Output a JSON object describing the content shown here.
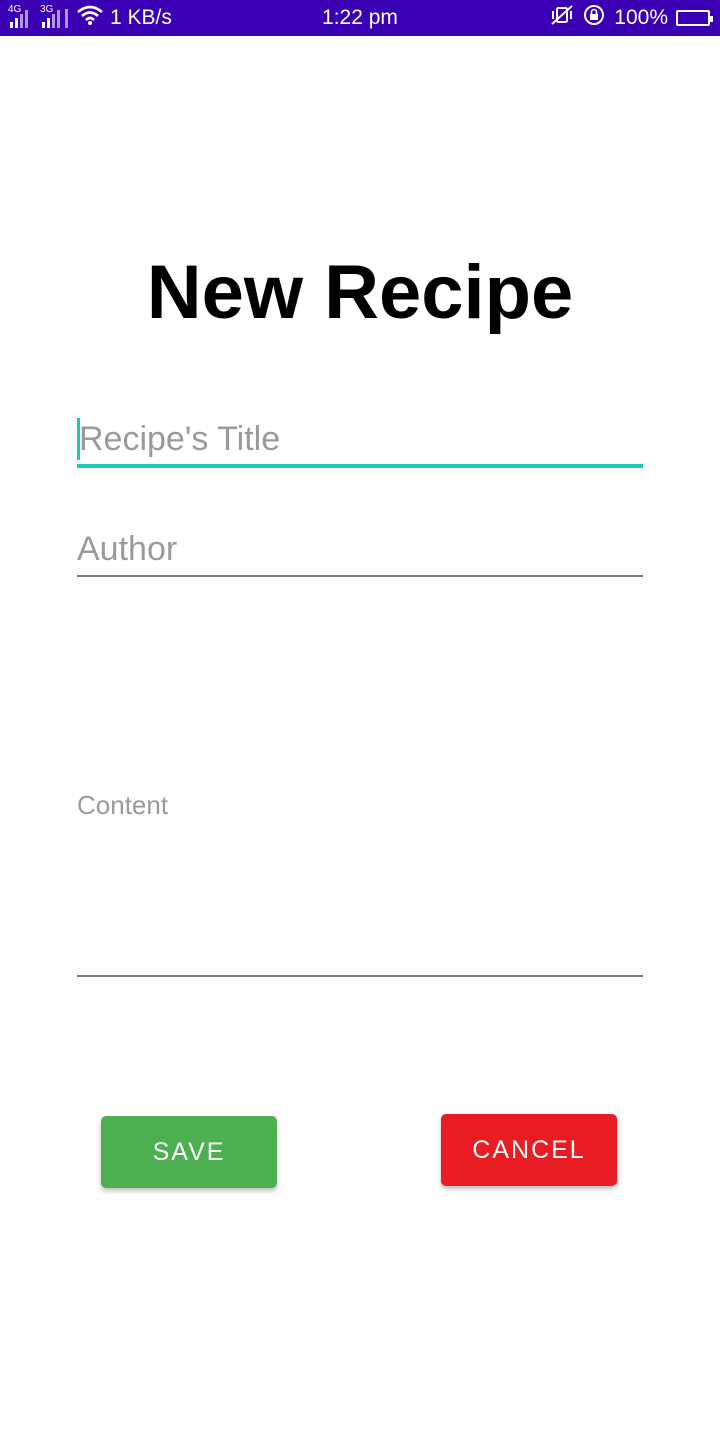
{
  "status_bar": {
    "network_1": "4G",
    "network_2": "3G",
    "speed": "1 KB/s",
    "time": "1:22 pm",
    "battery": "100%",
    "background_color": "#3c00b4",
    "icons": [
      "signal-icon",
      "signal-icon",
      "wifi-icon",
      "mute-vibrate-icon",
      "rotation-lock-icon",
      "battery-icon"
    ]
  },
  "page": {
    "title": "New Recipe"
  },
  "form": {
    "title_placeholder": "Recipe's Title",
    "title_value": "",
    "author_placeholder": "Author",
    "author_value": "",
    "content_placeholder": "Content",
    "content_value": "",
    "focus_color": "#1dc9b7"
  },
  "buttons": {
    "save_label": "SAVE",
    "save_color": "#4caf50",
    "cancel_label": "CANCEL",
    "cancel_color": "#e81c22"
  }
}
